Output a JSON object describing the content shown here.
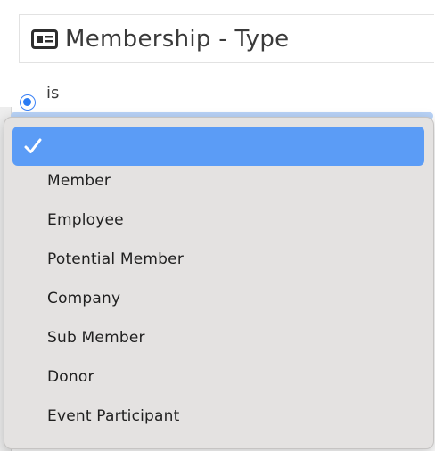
{
  "field": {
    "title": "Membership - Type",
    "icon": "id-card-icon"
  },
  "operator": {
    "label": "is",
    "selected": true
  },
  "dropdown": {
    "selected_index": 0,
    "options": [
      {
        "label": "",
        "selected": true
      },
      {
        "label": "Member",
        "selected": false
      },
      {
        "label": "Employee",
        "selected": false
      },
      {
        "label": "Potential Member",
        "selected": false
      },
      {
        "label": "Company",
        "selected": false
      },
      {
        "label": "Sub Member",
        "selected": false
      },
      {
        "label": "Donor",
        "selected": false
      },
      {
        "label": "Event Participant",
        "selected": false
      }
    ]
  },
  "colors": {
    "accent": "#5b9cf6",
    "radio": "#2a7cf4",
    "menu_bg": "#e4e2e1",
    "text": "#1f1f1f"
  }
}
